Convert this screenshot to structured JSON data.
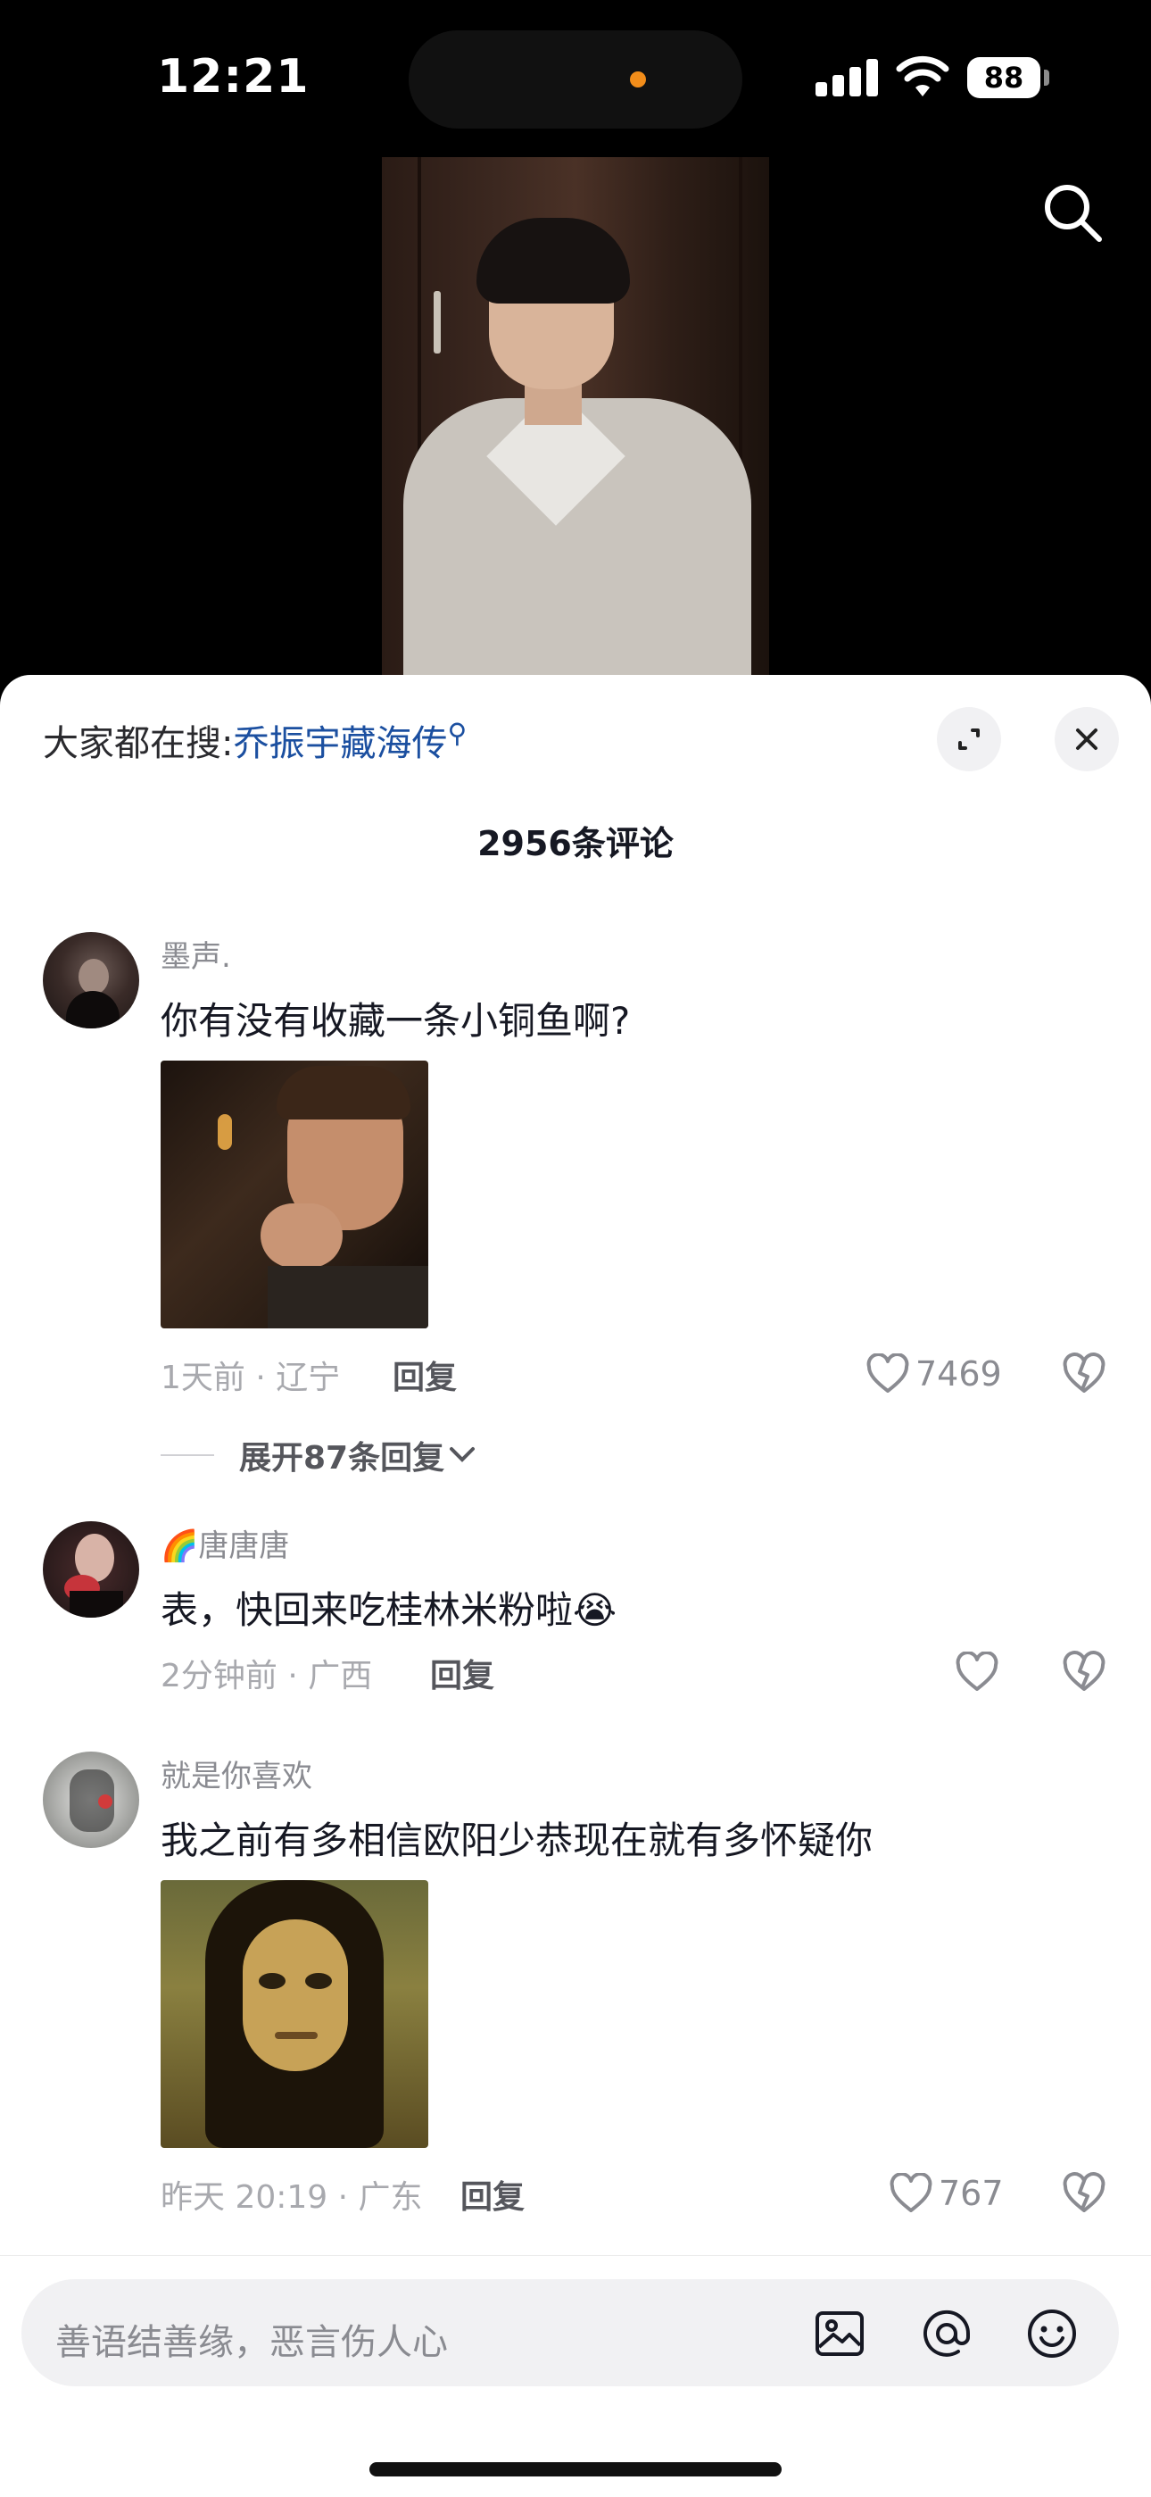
{
  "status": {
    "time": "12:21",
    "battery": "88"
  },
  "trending": {
    "prefix": "大家都在搜:",
    "keyword": "乔振宇藏海传"
  },
  "comments_count": "2956条评论",
  "comments": [
    {
      "username": "墨声.",
      "text": "你有没有收藏一条小铜鱼啊?",
      "meta": "1天前 · 辽宁",
      "reply_label": "回复",
      "likes": "7469"
    },
    {
      "username_prefix": "🌈",
      "username": "唐唐唐",
      "text": "表，快回来吃桂林米粉啦",
      "emoji": "😭",
      "meta": "2分钟前 · 广西",
      "reply_label": "回复",
      "likes": ""
    },
    {
      "username": "就是你喜欢",
      "text": "我之前有多相信欧阳少恭现在就有多怀疑你",
      "meta": "昨天 20:19 · 广东",
      "reply_label": "回复",
      "likes": "767"
    }
  ],
  "expand_replies": "展开87条回复",
  "input": {
    "placeholder": "善语结善缘，恶言伤人心"
  },
  "icons": [
    "search-icon",
    "expand-icon",
    "close-icon",
    "heart-icon",
    "dislike-icon",
    "image-icon",
    "at-icon",
    "emoji-icon",
    "chevron-down-icon"
  ]
}
